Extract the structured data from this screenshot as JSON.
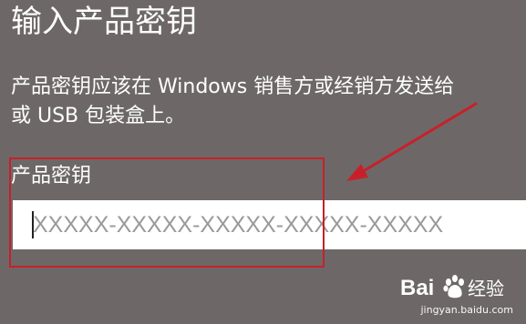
{
  "title": "输入产品密钥",
  "description": {
    "line1": "产品密钥应该在 Windows 销售方或经销方发送给",
    "line2": "或 USB 包装盒上。"
  },
  "product_key": {
    "label": "产品密钥",
    "placeholder": "XXXXX-XXXXX-XXXXX-XXXXX-XXXXX",
    "value": ""
  },
  "watermark": {
    "brand": "Bai经验",
    "url": "jingyan.baidu.com"
  },
  "colors": {
    "background": "#6d6867",
    "annotation_red": "#c8202a",
    "input_bg": "#ffffff",
    "placeholder_gray": "#9a9a9a"
  }
}
